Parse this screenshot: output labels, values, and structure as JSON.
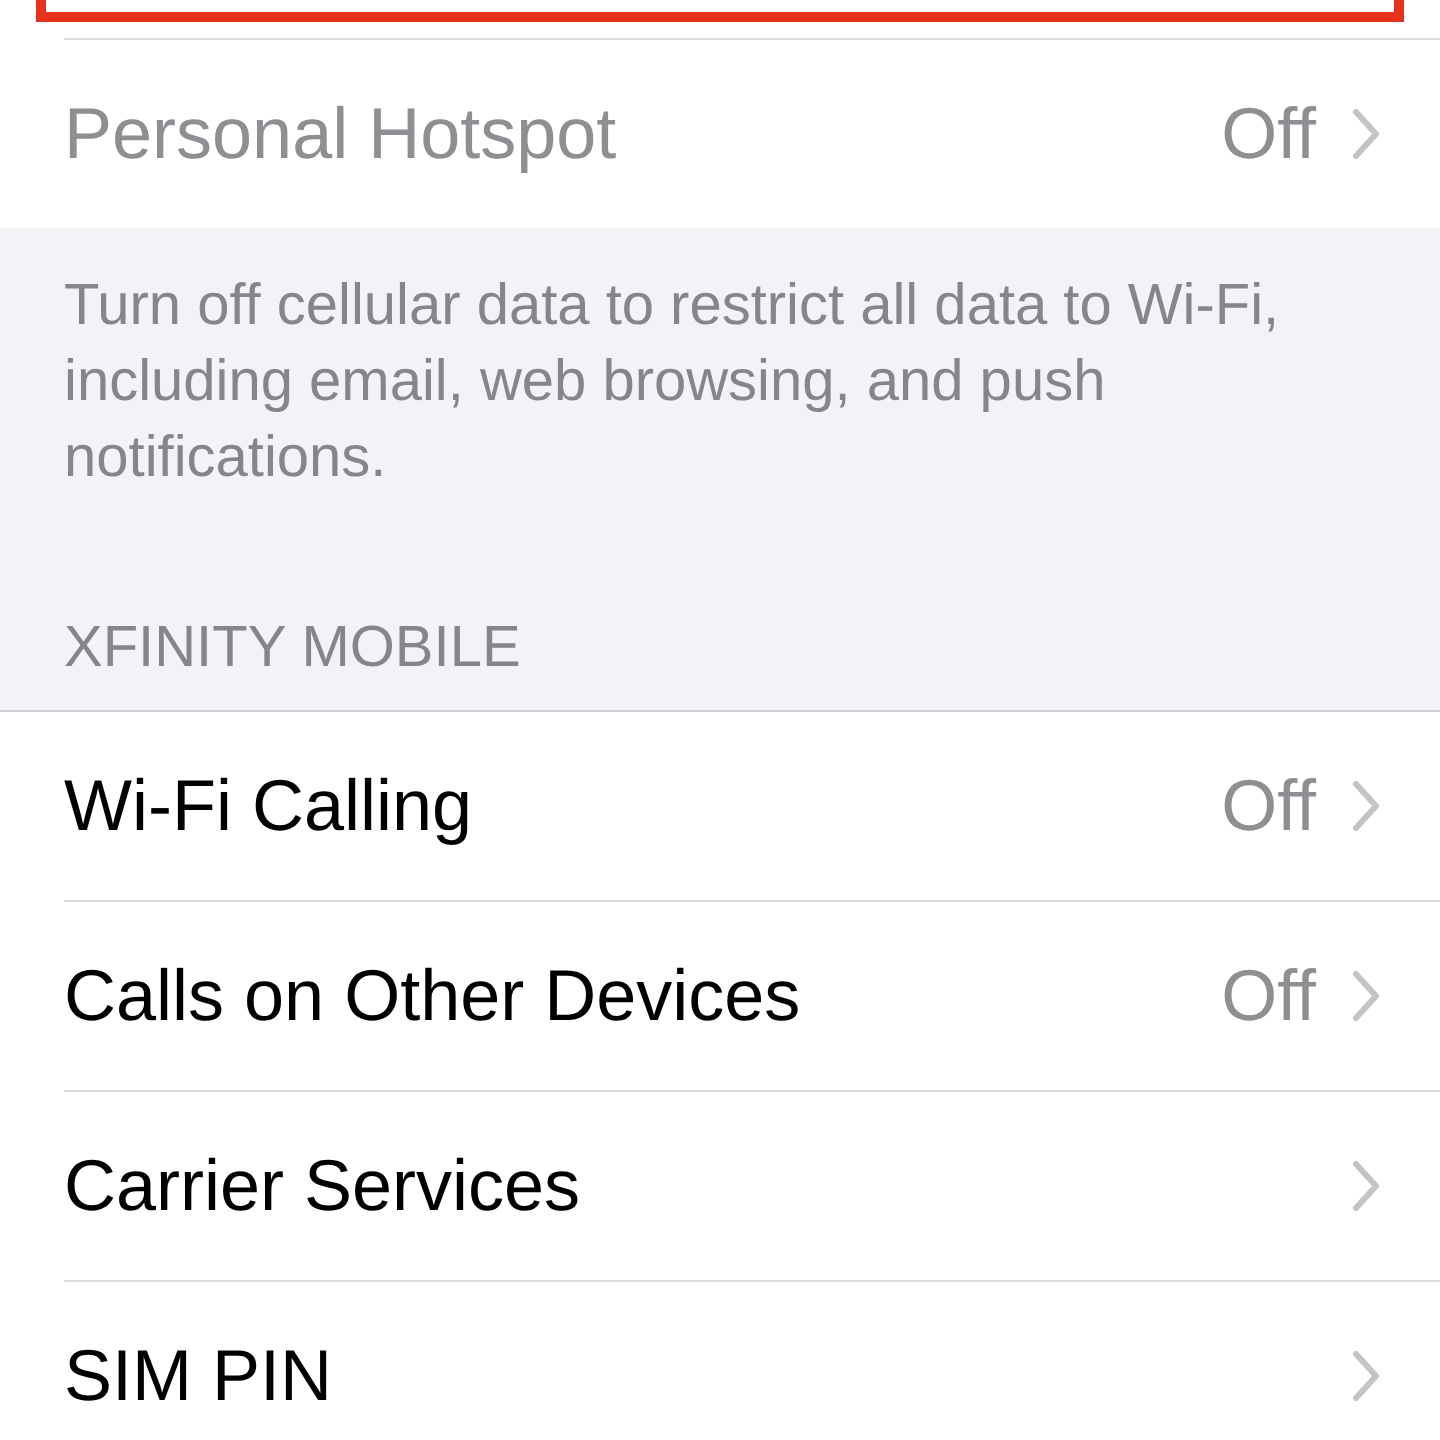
{
  "top_group": [
    {
      "label": "Personal Hotspot",
      "value": "Off",
      "disabled": true
    }
  ],
  "top_footer": "Turn off cellular data to restrict all data to Wi-Fi, including email, web browsing, and push notifications.",
  "section_header": "XFINITY MOBILE",
  "rows": [
    {
      "label": "Wi-Fi Calling",
      "value": "Off",
      "disabled": false
    },
    {
      "label": "Calls on Other Devices",
      "value": "Off",
      "disabled": false
    },
    {
      "label": "Carrier Services",
      "disabled": false
    },
    {
      "label": "SIM PIN",
      "disabled": false
    }
  ]
}
